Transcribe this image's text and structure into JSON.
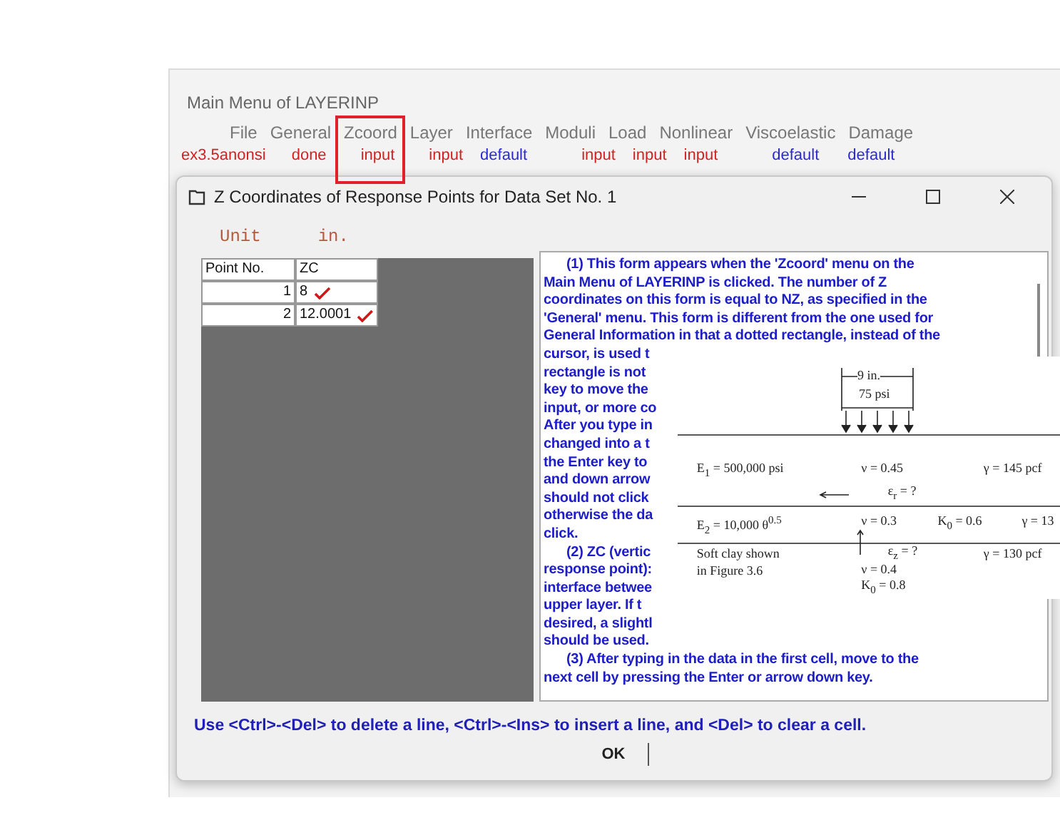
{
  "main_window": {
    "title": "Main Menu of LAYERINP",
    "menu": [
      {
        "label": "File",
        "highlighted": false
      },
      {
        "label": "General",
        "highlighted": false
      },
      {
        "label": "Zcoord",
        "highlighted": true
      },
      {
        "label": "Layer",
        "highlighted": false
      },
      {
        "label": "Interface",
        "highlighted": false
      },
      {
        "label": "Moduli",
        "highlighted": false
      },
      {
        "label": "Load",
        "highlighted": false
      },
      {
        "label": "Nonlinear",
        "highlighted": false
      },
      {
        "label": "Viscoelastic",
        "highlighted": false
      },
      {
        "label": "Damage",
        "highlighted": false
      }
    ],
    "status": [
      {
        "text": "ex3.5anonsi",
        "color": "#d42020"
      },
      {
        "text": "done",
        "color": "#d42020"
      },
      {
        "text": "input",
        "color": "#d42020"
      },
      {
        "text": "input",
        "color": "#d42020"
      },
      {
        "text": "default",
        "color": "#2a2ad0"
      },
      {
        "text": "input",
        "color": "#d42020"
      },
      {
        "text": "input",
        "color": "#d42020"
      },
      {
        "text": "input",
        "color": "#d42020"
      },
      {
        "text": "default",
        "color": "#2a2ad0"
      },
      {
        "text": "default",
        "color": "#2a2ad0"
      }
    ]
  },
  "dialog": {
    "title": "Z Coordinates of Response Points for Data Set No. 1",
    "unit_label": "Unit",
    "unit_value": "in.",
    "table": {
      "columns": [
        "Point No.",
        "ZC"
      ],
      "rows": [
        {
          "point": "1",
          "zc": "8",
          "checked": true
        },
        {
          "point": "2",
          "zc": "12.0001",
          "checked": true
        }
      ]
    },
    "help_paragraphs": [
      [
        "(1)  This form appears when the 'Zcoord' menu on the",
        "Main Menu of LAYERINP is clicked.  The number of Z",
        "coordinates on this form is equal to NZ, as specified in the",
        "'General' menu.  This form is different from the one used for",
        "General Information in that a dotted rectangle, instead of the",
        "cursor, is used t",
        "rectangle is not",
        "key to move the",
        "input, or more co",
        "After you type in",
        "changed into a t",
        "the Enter key to",
        "and down arrow",
        "should not click",
        "otherwise the da",
        "click."
      ],
      [
        "(2)  ZC (vertic",
        "response point):",
        "interface betwee",
        "upper layer.  If t",
        "desired, a slightl",
        "should be used."
      ],
      [
        "(3)  After typing in the data in the first cell, move to the",
        "next cell by pressing the Enter or arrow down key."
      ]
    ],
    "hint": "Use <Ctrl>-<Del> to delete a line, <Ctrl>-<Ins> to insert a line, and <Del> to clear a cell.",
    "ok_button": "OK"
  },
  "figure": {
    "width_label": "9 in.",
    "load_label": "75 psi",
    "labels": [
      "E$_{1}$ = 500,000 psi",
      "ν = 0.45",
      "γ = 145 pcf",
      "ε$_{r}$ = ?",
      "E$_{2}$ = 10,000 θ$^{0.5}$",
      "ν = 0.3",
      "K$_{0}$ = 0.6",
      "γ = 13",
      "Soft clay shown",
      "ε$_{z}$ = ?",
      "γ = 130 pcf",
      "in Figure 3.6",
      "ν = 0.4",
      "K$_{0}$ = 0.8"
    ]
  }
}
